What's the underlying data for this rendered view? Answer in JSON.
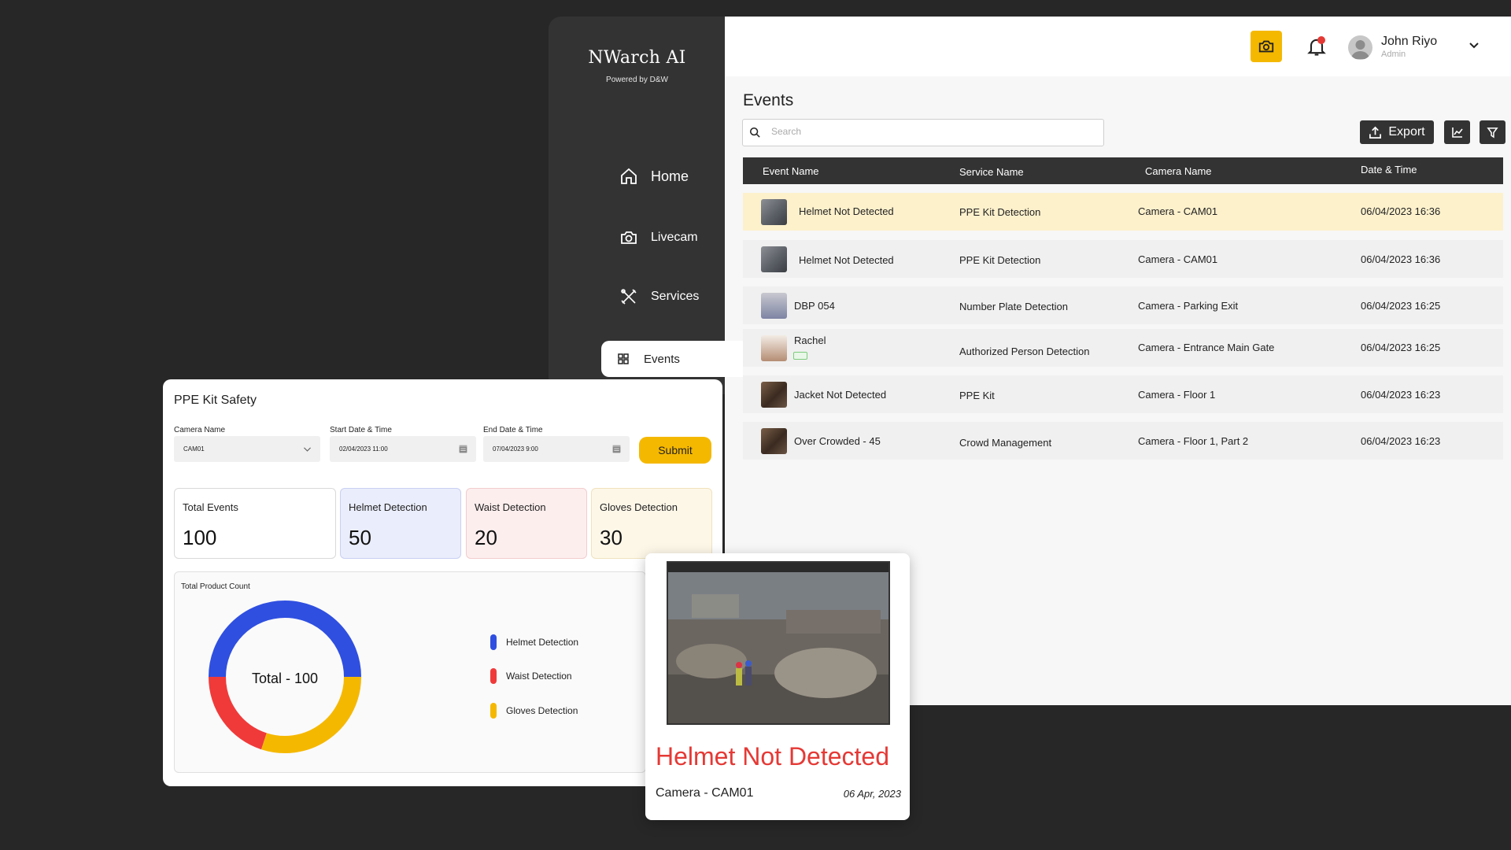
{
  "sidebar": {
    "brand": "NWarch AI",
    "tagline": "Powered by D&W",
    "items": [
      {
        "label": "Home",
        "icon": "home-icon"
      },
      {
        "label": "Livecam",
        "icon": "camera-icon"
      },
      {
        "label": "Services",
        "icon": "tools-icon"
      },
      {
        "label": "Events",
        "icon": "grid-icon"
      }
    ]
  },
  "header": {
    "user_name": "John Riyo",
    "user_role": "Admin",
    "accent": "#F5B800"
  },
  "events": {
    "title": "Events",
    "search_placeholder": "Search",
    "export_label": "Export",
    "columns": [
      "Event Name",
      "Service Name",
      "Camera Name",
      "Date & Time"
    ],
    "rows": [
      {
        "event": "Helmet Not Detected",
        "service": "PPE Kit Detection",
        "camera": "Camera - CAM01",
        "datetime": "06/04/2023 16:36"
      },
      {
        "event": "Helmet Not Detected",
        "service": "PPE Kit Detection",
        "camera": "Camera - CAM01",
        "datetime": "06/04/2023 16:36"
      },
      {
        "event": "DBP 054",
        "service": "Number Plate  Detection",
        "camera": "Camera - Parking Exit",
        "datetime": "06/04/2023 16:25"
      },
      {
        "event": "Rachel",
        "service": "Authorized Person Detection",
        "camera": "Camera - Entrance Main Gate",
        "datetime": "06/04/2023 16:25"
      },
      {
        "event": "Jacket Not Detected",
        "service": "PPE Kit",
        "camera": "Camera - Floor 1",
        "datetime": "06/04/2023 16:23"
      },
      {
        "event": "Over Crowded - 45",
        "service": "Crowd Management",
        "camera": "Camera - Floor 1, Part 2",
        "datetime": "06/04/2023 16:23"
      }
    ]
  },
  "ppe": {
    "title": "PPE Kit Safety",
    "camera_label": "Camera Name",
    "camera_value": "CAM01",
    "start_label": "Start Date & Time",
    "start_value": "02/04/2023 11:00",
    "end_label": "End Date & Time",
    "end_value": "07/04/2023 9:00",
    "submit_label": "Submit",
    "stats": [
      {
        "label": "Total Events",
        "value": "100"
      },
      {
        "label": "Helmet Detection",
        "value": "50"
      },
      {
        "label": "Waist Detection",
        "value": "20"
      },
      {
        "label": "Gloves Detection",
        "value": "30"
      }
    ]
  },
  "chart_data": {
    "type": "pie",
    "title": "Total Product Count",
    "center_label": "Total - 100",
    "categories": [
      "Helmet Detection",
      "Waist Detection",
      "Gloves Detection"
    ],
    "values": [
      50,
      20,
      30
    ],
    "colors": [
      "#2F4FE0",
      "#F03A3A",
      "#F5B800"
    ],
    "legend": "right"
  },
  "alert": {
    "title": "Helmet Not Detected",
    "camera": "Camera - CAM01",
    "date": "06 Apr, 2023"
  }
}
